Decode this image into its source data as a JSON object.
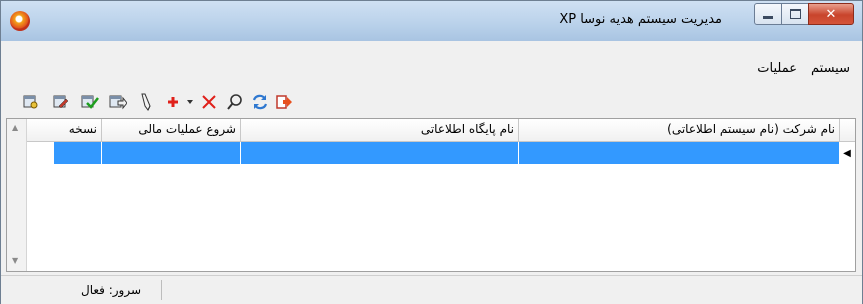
{
  "window": {
    "title": "مدیریت سیستم هدیه نوسا XP"
  },
  "menu": {
    "items": [
      "سیستم",
      "عملیات"
    ]
  },
  "toolbar": {
    "icons": [
      "db-key-icon",
      "db-edit-icon",
      "db-check-icon",
      "db-export-icon",
      "pencil-icon",
      "add-icon",
      "dropdown-arrow-icon",
      "delete-icon",
      "search-icon",
      "refresh-icon",
      "exit-icon"
    ]
  },
  "grid": {
    "columns": [
      "نام شرکت (نام سیستم اطلاعاتی)",
      "نام پایگاه اطلاعاتی",
      "شروع عملیات مالی",
      "نسخه"
    ]
  },
  "status": {
    "server": "سرور: فعال"
  },
  "colors": {
    "selection": "#3399ff",
    "titlebar": "#b9d1ea",
    "close": "#c8442c"
  }
}
